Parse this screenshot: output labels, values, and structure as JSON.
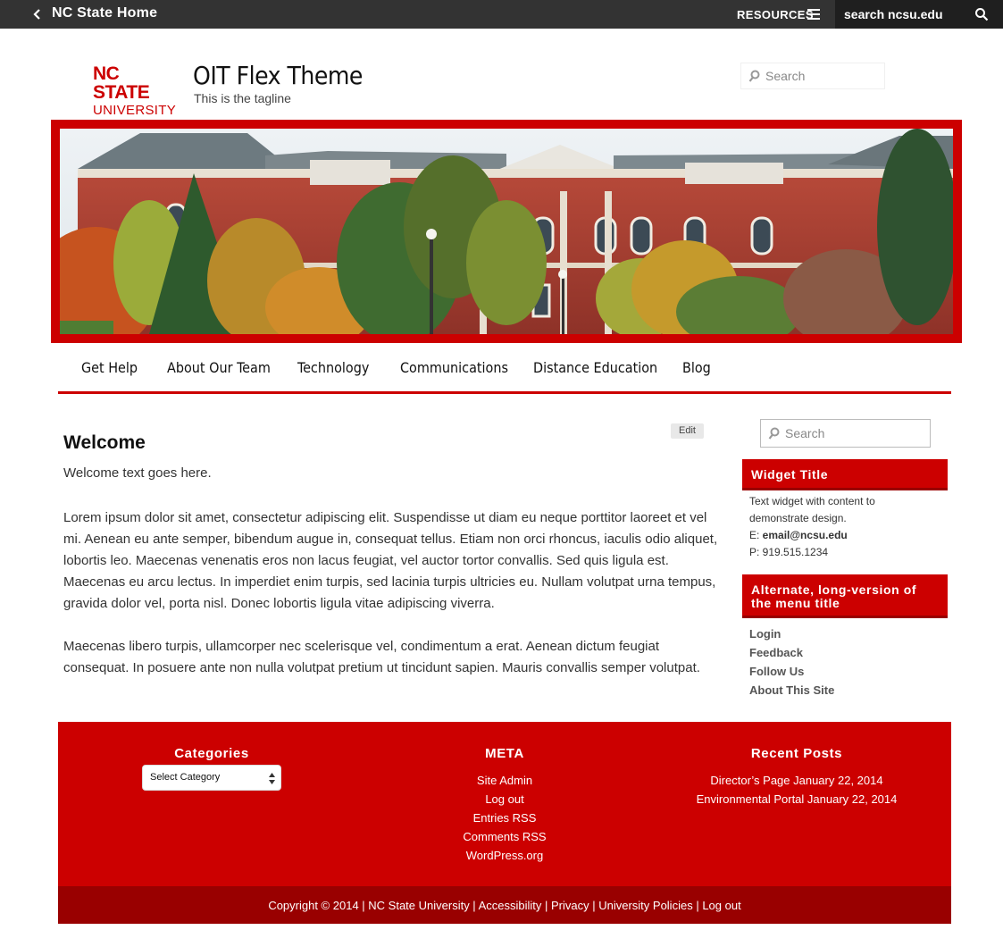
{
  "topbar": {
    "home_label": "NC State Home",
    "resources_label": "RESOURCES",
    "search_placeholder": "search ncsu.edu"
  },
  "header": {
    "logo_line1": "NC STATE",
    "logo_line2": "UNIVERSITY",
    "site_title": "OIT Flex Theme",
    "tagline": "This is the tagline",
    "search_placeholder": "Search"
  },
  "nav": {
    "items": [
      "Get Help",
      "About Our Team",
      "Technology",
      "Communications",
      "Distance Education",
      "Blog"
    ]
  },
  "content": {
    "edit_label": "Edit",
    "title": "Welcome",
    "intro": "Welcome text goes here.",
    "paragraphs": [
      "Lorem ipsum dolor sit amet, consectetur adipiscing elit. Suspendisse ut diam eu neque porttitor laoreet et vel mi. Aenean eu ante semper, bibendum augue in, consequat tellus. Etiam non orci rhoncus, iaculis odio aliquet, lobortis leo. Maecenas venenatis eros non lacus feugiat, vel auctor tortor convallis. Sed quis ligula est. Maecenas eu arcu lectus. In imperdiet enim turpis, sed lacinia turpis ultricies eu. Nullam volutpat urna tempus, gravida dolor vel, porta nisl. Donec lobortis ligula vitae adipiscing viverra.",
      "Maecenas libero turpis, ullamcorper nec scelerisque vel, condimentum a erat. Aenean dictum feugiat consequat. In posuere ante non nulla volutpat pretium ut tincidunt sapien. Mauris convallis semper volutpat."
    ]
  },
  "sidebar": {
    "search_placeholder": "Search",
    "widget1": {
      "title": "Widget Title",
      "text_line1": "Text widget with content to",
      "text_line2": "demonstrate design.",
      "email_prefix": "E: ",
      "email": "email@ncsu.edu",
      "phone": "P: 919.515.1234"
    },
    "widget2": {
      "title_line1": "Alternate, long-version of",
      "title_line2": "the menu title",
      "links": [
        "Login",
        "Feedback",
        "Follow Us",
        "About This Site"
      ]
    }
  },
  "footer": {
    "categories_title": "Categories",
    "category_select": "Select Category",
    "meta_title": "META",
    "meta_links": [
      "Site Admin",
      "Log out",
      "Entries RSS",
      "Comments RSS",
      "WordPress.org"
    ],
    "recent_title": "Recent Posts",
    "recent_posts": [
      "Director’s Page January 22, 2014",
      "Environmental Portal January 22, 2014"
    ],
    "copyright": "Copyright © 2014 | NC State University | ",
    "bottom_links": [
      "Accessibility",
      "Privacy",
      "University Policies",
      "Log out"
    ],
    "separator": " | "
  },
  "colors": {
    "brand_red": "#cc0000",
    "dark_red": "#990000",
    "topbar": "#333333"
  }
}
